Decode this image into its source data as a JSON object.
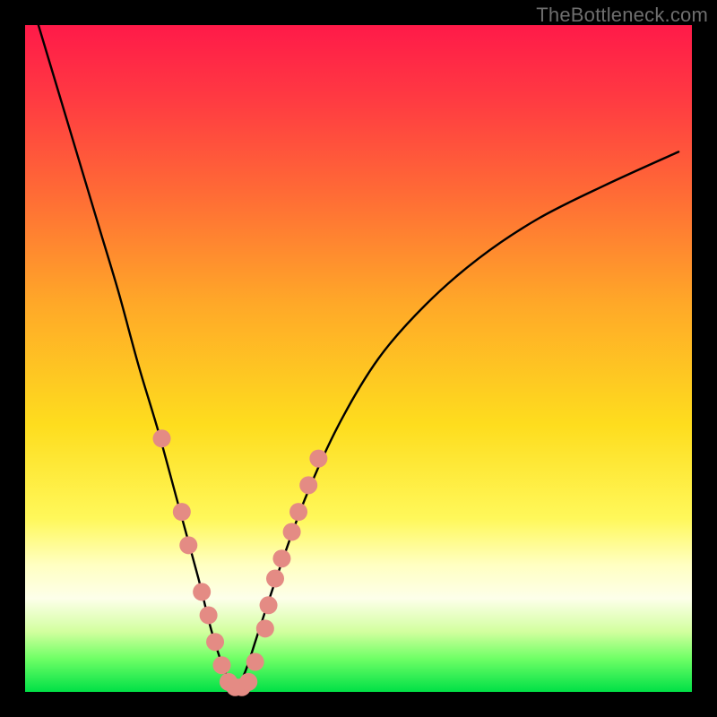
{
  "watermark": "TheBottleneck.com",
  "chart_data": {
    "type": "line",
    "title": "",
    "xlabel": "",
    "ylabel": "",
    "xlim": [
      0,
      100
    ],
    "ylim": [
      0,
      100
    ],
    "series": [
      {
        "name": "bottleneck-curve",
        "x": [
          2,
          5,
          8,
          11,
          14,
          17,
          20,
          23,
          26,
          28,
          30,
          31.5,
          33,
          35,
          38,
          42,
          47,
          53,
          60,
          68,
          77,
          87,
          98
        ],
        "values": [
          100,
          90,
          80,
          70,
          60,
          49,
          39,
          28,
          17,
          9,
          3,
          0.5,
          3,
          9,
          18,
          29,
          40,
          50,
          58,
          65,
          71,
          76,
          81
        ]
      }
    ],
    "markers": {
      "name": "highlight-points",
      "color": "#e48b84",
      "points": [
        {
          "x": 20.5,
          "y": 38
        },
        {
          "x": 23.5,
          "y": 27
        },
        {
          "x": 24.5,
          "y": 22
        },
        {
          "x": 26.5,
          "y": 15
        },
        {
          "x": 27.5,
          "y": 11.5
        },
        {
          "x": 28.5,
          "y": 7.5
        },
        {
          "x": 29.5,
          "y": 4
        },
        {
          "x": 30.5,
          "y": 1.5
        },
        {
          "x": 31.5,
          "y": 0.7
        },
        {
          "x": 32.5,
          "y": 0.7
        },
        {
          "x": 33.5,
          "y": 1.5
        },
        {
          "x": 34.5,
          "y": 4.5
        },
        {
          "x": 36.0,
          "y": 9.5
        },
        {
          "x": 36.5,
          "y": 13
        },
        {
          "x": 37.5,
          "y": 17
        },
        {
          "x": 38.5,
          "y": 20
        },
        {
          "x": 40.0,
          "y": 24
        },
        {
          "x": 41.0,
          "y": 27
        },
        {
          "x": 42.5,
          "y": 31
        },
        {
          "x": 44.0,
          "y": 35
        }
      ]
    }
  }
}
